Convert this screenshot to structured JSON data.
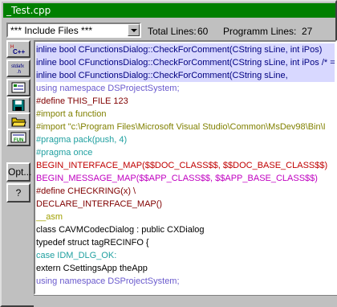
{
  "window": {
    "title": "_Test.cpp"
  },
  "combo": {
    "value": "*** Include Files ***"
  },
  "stats": {
    "total_label": "Total Lines:",
    "total_value": "60",
    "prog_label": "Programm Lines:",
    "prog_value": "27"
  },
  "toolbar": {
    "options_label": "Opt...",
    "help_label": "?",
    "icons": [
      "cpp-icon",
      "stdafx-icon",
      "new-icon",
      "save-icon",
      "open-icon",
      "fun-icon"
    ]
  },
  "lines": [
    {
      "text": "inline bool CFunctionsDialog::CheckForComment(CString sLine, int iPos)",
      "color": "#000080",
      "highlight": true
    },
    {
      "text": "inline bool CFunctionsDialog::CheckForComment(CString sLine, int iPos /* =",
      "color": "#000080",
      "highlight": true
    },
    {
      "text": "inline bool CFunctionsDialog::CheckForComment(CString sLine,",
      "color": "#000080",
      "highlight": true
    },
    {
      "text": "using namespace DSProjectSystem;",
      "color": "#6a5acd",
      "highlight": false
    },
    {
      "text": "#define THIS_FILE 123",
      "color": "#800000",
      "highlight": false
    },
    {
      "text": "#import a function",
      "color": "#808000",
      "highlight": false
    },
    {
      "text": "#import \"c:\\Program Files\\Microsoft Visual Studio\\Common\\MsDev98\\Bin\\I",
      "color": "#808000",
      "highlight": false
    },
    {
      "text": "#pragma pack(push, 4)",
      "color": "#20a0a0",
      "highlight": false
    },
    {
      "text": "#pragma once",
      "color": "#20a0a0",
      "highlight": false
    },
    {
      "text": "BEGIN_INTERFACE_MAP($$DOC_CLASS$$, $$DOC_BASE_CLASS$$)",
      "color": "#c00000",
      "highlight": false
    },
    {
      "text": "BEGIN_MESSAGE_MAP($$APP_CLASS$$, $$APP_BASE_CLASS$$)",
      "color": "#c000c0",
      "highlight": false
    },
    {
      "text": "#define CHECKRING(x) \\",
      "color": "#800000",
      "highlight": false
    },
    {
      "text": "DECLARE_INTERFACE_MAP()",
      "color": "#800000",
      "highlight": false
    },
    {
      "text": "__asm",
      "color": "#a0a000",
      "highlight": false
    },
    {
      "text": "class CAVMCodecDialog : public CXDialog",
      "color": "#000000",
      "highlight": false
    },
    {
      "text": "typedef struct tagRECINFO {",
      "color": "#000000",
      "highlight": false
    },
    {
      "text": "case IDM_DLG_OK:",
      "color": "#20a0a0",
      "highlight": false
    },
    {
      "text": "extern CSettingsApp theApp",
      "color": "#000000",
      "highlight": false
    },
    {
      "text": "using namespace DSProjectSystem;",
      "color": "#6a5acd",
      "highlight": false
    }
  ],
  "colors": {
    "title_bar": "#008000",
    "face": "#c0c0c0",
    "highlight_line": "#d8d8ff"
  }
}
